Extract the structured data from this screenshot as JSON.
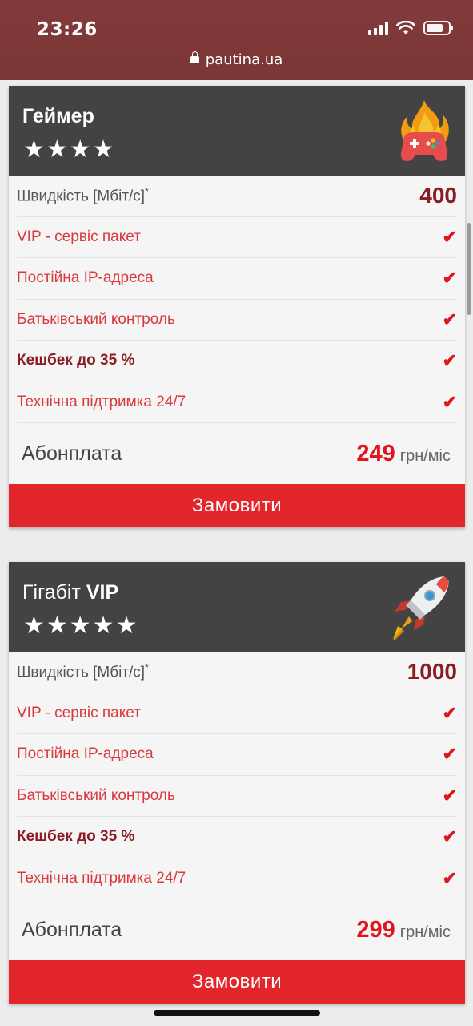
{
  "status": {
    "time": "23:26",
    "url": "pautina.ua"
  },
  "plans": [
    {
      "title_regular": "",
      "title_bold": "Геймер",
      "stars": "★★★★",
      "rating": 4,
      "icon": "gamepad-fire-icon",
      "speed_label": "Швидкість [Мбіт/с]",
      "speed_note": "*",
      "speed_value": "400",
      "features": [
        {
          "label": "VIP - сервіс пакет",
          "check": "✔"
        },
        {
          "label": "Постійна IP-адреса",
          "check": "✔"
        },
        {
          "label": "Батьківський контроль",
          "check": "✔"
        },
        {
          "label": "Кешбек до 35 %",
          "check": "✔",
          "bold": true
        },
        {
          "label": "Технічна підтримка 24/7",
          "check": "✔"
        }
      ],
      "price_label": "Абонплата",
      "price": "249",
      "price_unit": "грн/міс",
      "order_label": "Замовити"
    },
    {
      "title_regular": "Гігабіт ",
      "title_bold": "VIP",
      "stars": "★★★★★",
      "rating": 5,
      "icon": "rocket-icon",
      "speed_label": "Швидкість [Мбіт/с]",
      "speed_note": "*",
      "speed_value": "1000",
      "features": [
        {
          "label": "VIP - сервіс пакет",
          "check": "✔"
        },
        {
          "label": "Постійна IP-адреса",
          "check": "✔"
        },
        {
          "label": "Батьківський контроль",
          "check": "✔"
        },
        {
          "label": "Кешбек до 35 %",
          "check": "✔",
          "bold": true
        },
        {
          "label": "Технічна підтримка 24/7",
          "check": "✔"
        }
      ],
      "price_label": "Абонплата",
      "price": "299",
      "price_unit": "грн/міс",
      "order_label": "Замовити"
    }
  ],
  "colors": {
    "accent": "#e3252c",
    "header": "#434343",
    "dark_red": "#8a1c24",
    "status_bar": "#7d3838"
  }
}
